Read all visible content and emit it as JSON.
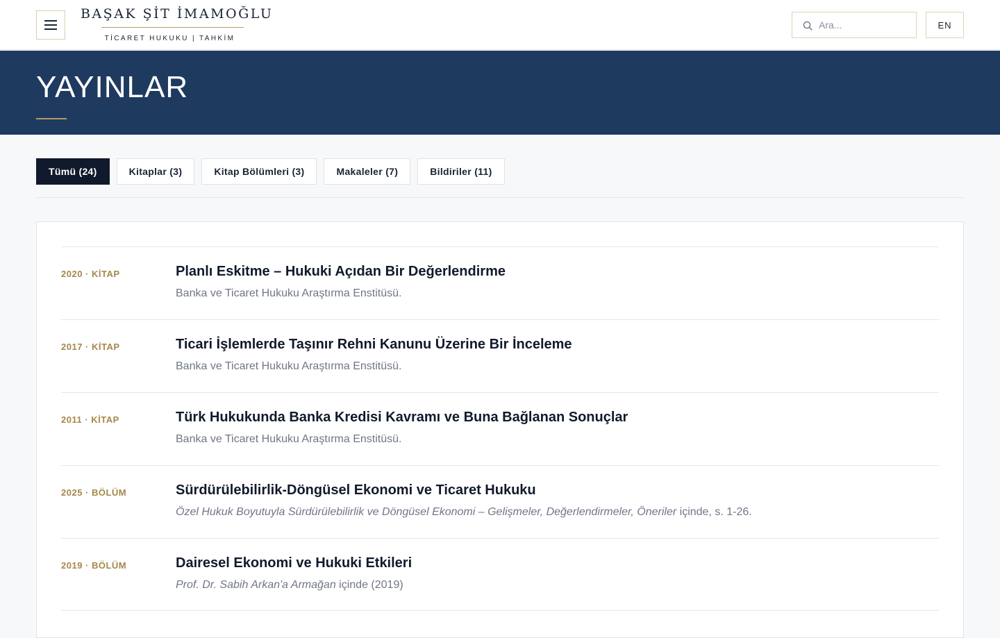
{
  "header": {
    "logo_name": "BAŞAK ŞİT İMAMOĞLU",
    "logo_tagline": "TİCARET HUKUKU | TAHKİM",
    "search_placeholder": "Ara...",
    "lang_label": "EN"
  },
  "hero": {
    "title": "YAYINLAR"
  },
  "tabs": [
    {
      "label": "Tümü (24)",
      "active": true
    },
    {
      "label": "Kitaplar (3)",
      "active": false
    },
    {
      "label": "Kitap Bölümleri (3)",
      "active": false
    },
    {
      "label": "Makaleler (7)",
      "active": false
    },
    {
      "label": "Bildiriler (11)",
      "active": false
    }
  ],
  "publications": [
    {
      "meta": "2020 · KİTAP",
      "title": "Planlı Eskitme – Hukuki Açıdan Bir Değerlendirme",
      "source_italic": "",
      "source_plain": "Banka ve Ticaret Hukuku Araştırma Enstitüsü."
    },
    {
      "meta": "2017 · KİTAP",
      "title": "Ticari İşlemlerde Taşınır Rehni Kanunu Üzerine Bir İnceleme",
      "source_italic": "",
      "source_plain": "Banka ve Ticaret Hukuku Araştırma Enstitüsü."
    },
    {
      "meta": "2011 · KİTAP",
      "title": "Türk Hukukunda Banka Kredisi Kavramı ve Buna Bağlanan Sonuçlar",
      "source_italic": "",
      "source_plain": "Banka ve Ticaret Hukuku Araştırma Enstitüsü."
    },
    {
      "meta": "2025 · BÖLÜM",
      "title": "Sürdürülebilirlik-Döngüsel Ekonomi ve Ticaret Hukuku",
      "source_italic": "Özel Hukuk Boyutuyla Sürdürülebilirlik ve Döngüsel Ekonomi – Gelişmeler, Değerlendirmeler, Öneriler",
      "source_plain": " içinde, s. 1-26."
    },
    {
      "meta": "2019 · BÖLÜM",
      "title": "Dairesel Ekonomi ve Hukuki Etkileri",
      "source_italic": "Prof. Dr. Sabih Arkan'a Armağan",
      "source_plain": " içinde (2019)"
    }
  ]
}
